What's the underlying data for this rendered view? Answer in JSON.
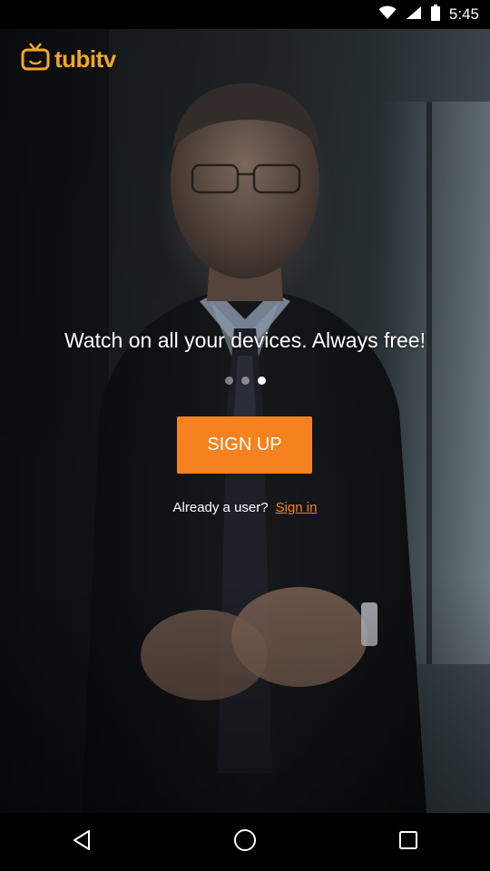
{
  "status_bar": {
    "time": "5:45"
  },
  "app": {
    "logo_text": "tubitv",
    "tagline": "Watch on all your devices. Always free!",
    "carousel": {
      "total_pages": 3,
      "active_page": 3
    },
    "signup_label": "SIGN UP",
    "already_user_text": "Already a user?",
    "signin_label": "Sign in"
  },
  "colors": {
    "brand_accent": "#f5821f",
    "logo_color": "#f5a623"
  },
  "icons": {
    "status": [
      "wifi-icon",
      "cellular-signal-icon",
      "battery-icon"
    ],
    "nav": [
      "back-icon",
      "home-icon",
      "recents-icon"
    ]
  }
}
